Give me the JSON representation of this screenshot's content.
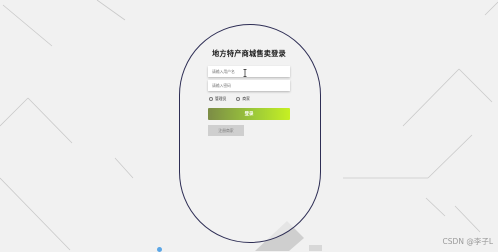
{
  "form": {
    "title": "地方特产商城售卖登录",
    "username_placeholder": "请输入用户名",
    "password_placeholder": "请输入密码",
    "roles": [
      {
        "label": "管理员"
      },
      {
        "label": "商家"
      }
    ],
    "login_label": "登录",
    "register_label": "注册商家"
  },
  "watermark": "CSDN @李子L",
  "colors": {
    "background": "#f1f1f1",
    "panel_border": "#2e2e55",
    "login_gradient_start": "#7c8c46",
    "login_gradient_end": "#c6f022",
    "register_bg": "#cfcfcf"
  },
  "icons": {
    "text_cursor": "i-beam-cursor-icon"
  }
}
